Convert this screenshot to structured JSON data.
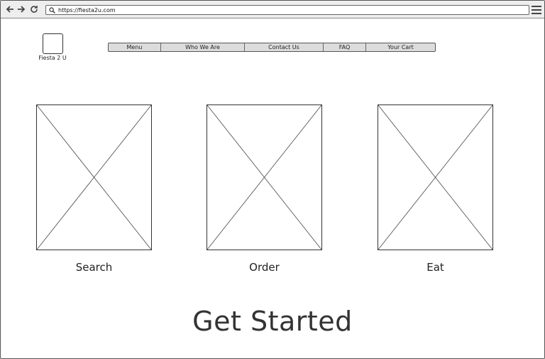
{
  "browser": {
    "url": "https://fiesta2u.com"
  },
  "brand": {
    "name": "Fiesta 2 U"
  },
  "nav": {
    "items": [
      {
        "label": "Menu"
      },
      {
        "label": "Who We Are"
      },
      {
        "label": "Contact Us"
      },
      {
        "label": "FAQ"
      },
      {
        "label": "Your Cart"
      }
    ]
  },
  "cards": [
    {
      "label": "Search"
    },
    {
      "label": "Order"
    },
    {
      "label": "Eat"
    }
  ],
  "cta": {
    "label": "Get Started"
  }
}
